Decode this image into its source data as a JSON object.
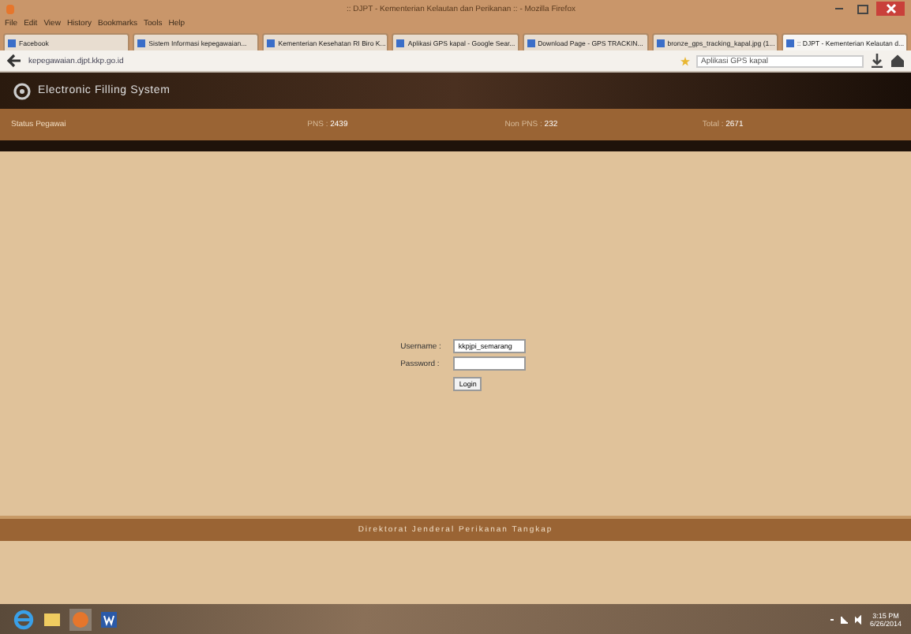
{
  "window": {
    "title": ":: DJPT - Kementerian Kelautan dan Perikanan :: - Mozilla Firefox"
  },
  "menu": [
    "File",
    "Edit",
    "View",
    "History",
    "Bookmarks",
    "Tools",
    "Help"
  ],
  "tabs": [
    {
      "label": "Facebook",
      "selected": false
    },
    {
      "label": "Sistem Informasi kepegawaian...",
      "selected": false
    },
    {
      "label": "Kementerian Kesehatan RI Biro K...",
      "selected": false
    },
    {
      "label": "Aplikasi GPS kapal - Google Sear...",
      "selected": false
    },
    {
      "label": "Download Page - GPS TRACKIN...",
      "selected": false
    },
    {
      "label": "bronze_gps_tracking_kapal.jpg (1...",
      "selected": false
    },
    {
      "label": ":: DJPT - Kementerian Kelautan d...",
      "selected": true
    }
  ],
  "address_bar": {
    "url": "kepegawaian.djpt.kkp.go.id",
    "search": "Aplikasi GPS kapal"
  },
  "site": {
    "title": "Electronic Filling System"
  },
  "status_bar": {
    "label": "Status Pegawai",
    "stats": [
      {
        "label": "PNS :",
        "value": "2439"
      },
      {
        "label": "Non PNS :",
        "value": "232"
      },
      {
        "label": "Total :",
        "value": "2671"
      }
    ]
  },
  "login": {
    "fields": [
      {
        "label": "Username :",
        "value": "kkpjpi_semarang"
      },
      {
        "label": "Password :"
      }
    ],
    "button": "Login"
  },
  "footer": "Direktorat Jenderal Perikanan Tangkap",
  "taskbar": {
    "time": "3:15 PM",
    "date": "6/26/2014"
  }
}
